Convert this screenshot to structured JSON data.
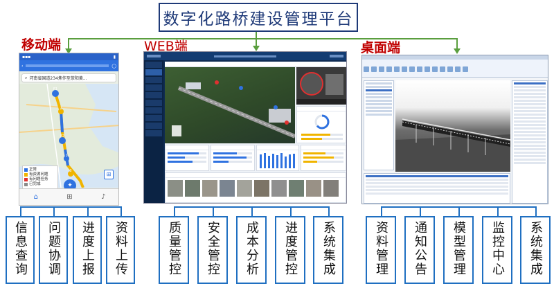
{
  "title": "数字化路桥建设管理平台",
  "clients": {
    "mobile": {
      "label": "移动端"
    },
    "web": {
      "label": "WEB端"
    },
    "desktop": {
      "label": "桌面端"
    }
  },
  "features": {
    "mobile": [
      "信息查询",
      "问题协调",
      "进度上报",
      "资料上传"
    ],
    "web": [
      "质量管控",
      "安全管控",
      "成本分析",
      "进度管控",
      "系统集成"
    ],
    "desktop": [
      "资料管理",
      "通知公告",
      "模型管理",
      "监控中心",
      "系统集成"
    ]
  },
  "mobile_screen": {
    "search_text": "河南省国道234焦作至荥阳黄...",
    "legend": [
      {
        "label": "正常",
        "color": "#2f72e0"
      },
      {
        "label": "有资源问题",
        "color": "#f0b400"
      },
      {
        "label": "有问题任务",
        "color": "#e03030"
      },
      {
        "label": "已完成",
        "color": "#8a8a8a"
      }
    ],
    "markers": [
      "F1",
      "F2",
      "1",
      "2",
      "3"
    ]
  },
  "colors": {
    "title_border": "#1f3a78",
    "connector": "#5a9e3e",
    "client_label": "#c00000",
    "feature_border": "#1f6fc1"
  }
}
